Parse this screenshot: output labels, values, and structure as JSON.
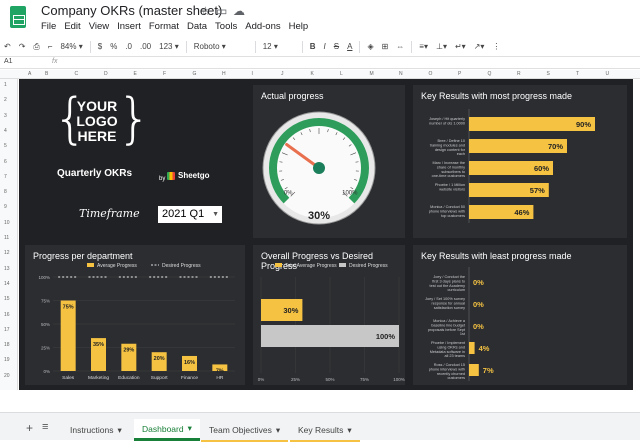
{
  "app": {
    "doc_title": "Company OKRs (master sheet)",
    "menu": [
      "File",
      "Edit",
      "View",
      "Insert",
      "Format",
      "Data",
      "Tools",
      "Add-ons",
      "Help"
    ]
  },
  "toolbar": {
    "zoom": "84%",
    "currency": "$",
    "percent": "%",
    "dec_less": ".0",
    "dec_more": ".00",
    "format_more": "123",
    "font": "Roboto",
    "font_size": "12",
    "bold": "B",
    "italic": "I",
    "strike": "S",
    "text_color": "A"
  },
  "formula_bar": {
    "cell_ref": "A1",
    "fx": "fx"
  },
  "columns": [
    "A",
    "B",
    "C",
    "D",
    "E",
    "F",
    "G",
    "H",
    "I",
    "J",
    "K",
    "L",
    "M",
    "N",
    "O",
    "P",
    "Q",
    "R",
    "S",
    "T",
    "U"
  ],
  "rows": [
    "1",
    "2",
    "3",
    "4",
    "5",
    "6",
    "7",
    "8",
    "9",
    "10",
    "11",
    "12",
    "13",
    "14",
    "15",
    "16",
    "17",
    "18",
    "19",
    "20"
  ],
  "dashboard": {
    "logo_lines": [
      "YOUR",
      "LOGO",
      "HERE"
    ],
    "subtitle": "Quarterly OKRs",
    "by": "by",
    "sheetgo": "Sheetgo",
    "timeframe_label": "Timeframe",
    "timeframe_value": "2021 Q1",
    "panels": {
      "actual_progress": "Actual progress",
      "most_progress": "Key Results with most progress made",
      "per_department": "Progress per department",
      "overall_vs_desired": "Overall Progress vs Desired Progress",
      "least_progress": "Key Results with least progress made"
    }
  },
  "colors": {
    "accent": "#f5c242",
    "bar_gray": "#c7c7c7",
    "panel_bg": "#2b2d31",
    "dash_bg": "#202124",
    "gauge_needle": "#e8704f",
    "gauge_hub": "#1a7f5a"
  },
  "chart_data": [
    {
      "type": "gauge",
      "title": "Actual progress",
      "value": 30,
      "value_label": "30%",
      "min_label": "0%",
      "max_label": "100%",
      "range": [
        0,
        100
      ]
    },
    {
      "type": "bar",
      "orientation": "horizontal",
      "title": "Key Results with most progress made",
      "categories": [
        "Joseph / Hit quarterly number of ots 1.0000",
        "Bree / Define 10 training modules and design content for each",
        "Marc / Increase the share of monthly subscribers to one-time customers",
        "Phoebe / 1 Million website visitors",
        "Monica / Conduct 50 phone interviews with top customers"
      ],
      "values": [
        90,
        70,
        60,
        57,
        46
      ],
      "labels": [
        "90%",
        "70%",
        "60%",
        "57%",
        "46%"
      ],
      "xlim": [
        0,
        100
      ]
    },
    {
      "type": "bar",
      "title": "Progress per department",
      "categories": [
        "Sales",
        "Marketing",
        "Education",
        "Support",
        "Finance",
        "HR"
      ],
      "series": [
        {
          "name": "Average Progress",
          "values": [
            75,
            35,
            29,
            20,
            16,
            7
          ]
        },
        {
          "name": "Desired Progress",
          "values": [
            100,
            100,
            100,
            100,
            100,
            100
          ]
        }
      ],
      "labels": [
        "75%",
        "35%",
        "29%",
        "20%",
        "16%",
        "7%"
      ],
      "ylim": [
        0,
        100
      ],
      "yticks": [
        "0%",
        "25%",
        "50%",
        "75%",
        "100%"
      ],
      "legend": "top"
    },
    {
      "type": "bar",
      "orientation": "horizontal",
      "title": "Overall Progress vs Desired Progress",
      "categories": [
        "Total Average Progress",
        "Desired Progress"
      ],
      "series": [
        {
          "name": "Total Average Progress",
          "values": [
            30
          ]
        },
        {
          "name": "Desired Progress",
          "values": [
            100
          ]
        }
      ],
      "labels": [
        "30%",
        "100%"
      ],
      "xlim": [
        0,
        100
      ],
      "xticks": [
        "0%",
        "25%",
        "50%",
        "75%",
        "100%"
      ],
      "legend": "top"
    },
    {
      "type": "bar",
      "orientation": "horizontal",
      "title": "Key Results with least progress made",
      "categories": [
        "Joey / Conduct the first 3 days plans to test out the Academy curriculum",
        "Joey / Set 100% survey response for annual satisfaction survey",
        "Monica / Achieve a baseline line budget proposals before Sept 1st",
        "Phoebe / Implement using OKRs and Metadata software in all 23 teams",
        "Ross / Conduct 15 phone interviews with recently churned customers"
      ],
      "values": [
        0,
        0,
        0,
        4,
        7
      ],
      "labels": [
        "0%",
        "0%",
        "0%",
        "4%",
        "7%"
      ],
      "xlim": [
        0,
        100
      ]
    }
  ],
  "tabs": {
    "add": "+",
    "list": "≡",
    "items": [
      "Instructions",
      "Dashboard",
      "Team Objectives",
      "Key Results"
    ],
    "active": "Dashboard"
  }
}
